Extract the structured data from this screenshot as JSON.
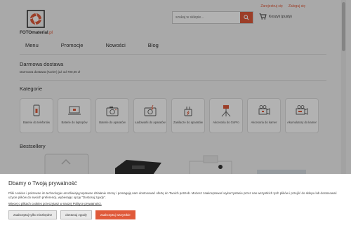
{
  "header": {
    "top_links": [
      "Zarejestruj się",
      "Zaloguj się"
    ],
    "logo_text": "FOTOmaterial",
    "logo_suffix": ".pl",
    "search_placeholder": "szukaj w sklepie...",
    "cart_label": "Koszyk (pusty)"
  },
  "nav": [
    "Menu",
    "Promocje",
    "Nowości",
    "Blog"
  ],
  "shipping": {
    "title": "Darmowa dostawa",
    "text": "Darmowa dostawa (Kurier) już od 700,00 zł"
  },
  "categories": {
    "title": "Kategorie",
    "items": [
      {
        "label": "Baterie do telefonów",
        "icon": "phone-icon"
      },
      {
        "label": "Baterie do laptopów",
        "icon": "laptop-icon"
      },
      {
        "label": "Baterie do aparatów",
        "icon": "camera-icon"
      },
      {
        "label": "Ładowarki do aparatów",
        "icon": "charger-icon"
      },
      {
        "label": "Zasilacze do aparatów",
        "icon": "power-adapter-icon"
      },
      {
        "label": "Akcesoria do GoPro",
        "icon": "gopro-tripod-icon"
      },
      {
        "label": "Akcesoria do kamer",
        "icon": "video-camera-icon"
      },
      {
        "label": "Akumulatory do kamer",
        "icon": "camcorder-battery-icon"
      }
    ]
  },
  "bestsellers": {
    "title": "Bestsellery"
  },
  "cookie": {
    "title": "Dbamy o Twoją prywatność",
    "text": "Pliki cookies i pokrewne im technologie umożliwiają poprawne działanie strony i pomagają nam dostosować ofertę do Twoich potrzeb. Możesz zaakceptować wykorzystanie przez nas wszystkich tych plików i przejść do sklepu lub dostosować użycie plików do swoich preferencji, wybierając opcję \"Dostosuj zgody\".",
    "policy_link": "Więcej o plikach cookies przeczytasz w naszej Polityce prywatności.",
    "buttons": {
      "necessary": "zaakceptuj tylko niezbędne",
      "customize": "dostosuj zgody",
      "accept_all": "zaakceptuj wszystkie"
    }
  },
  "colors": {
    "accent": "#e05a3a"
  }
}
